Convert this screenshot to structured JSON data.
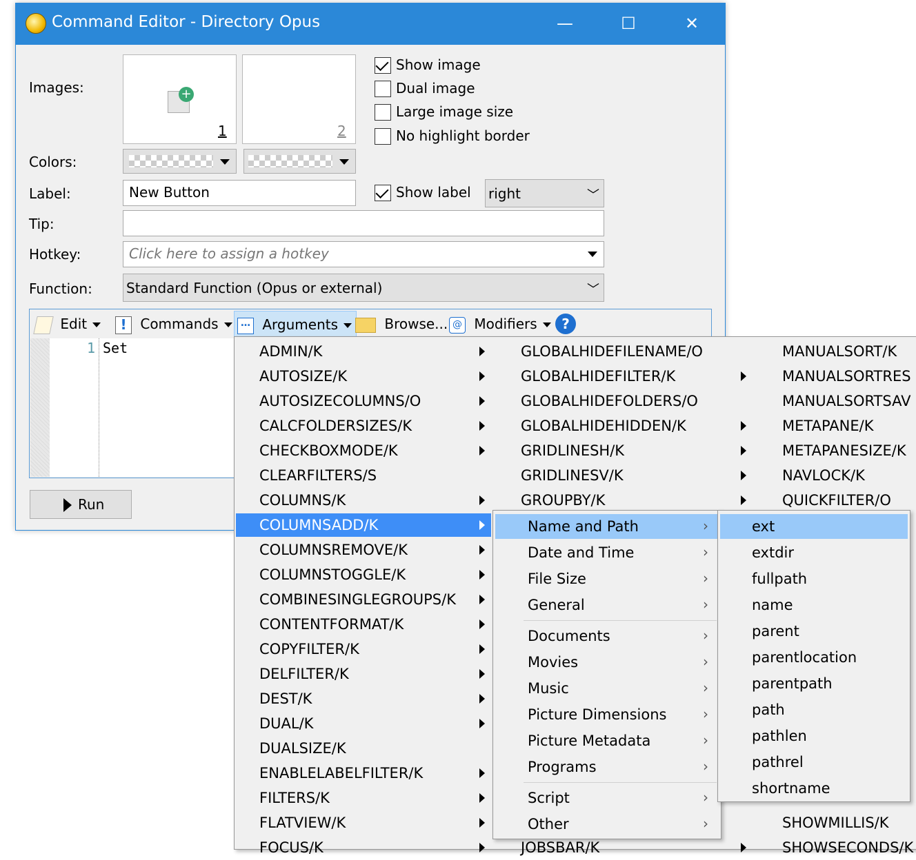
{
  "window": {
    "title": "Command Editor - Directory Opus",
    "minimize": "—",
    "maximize": "☐",
    "close": "✕"
  },
  "form": {
    "images_label": "Images:",
    "image1_num": "1",
    "image2_num": "2",
    "show_image": "Show image",
    "dual_image": "Dual image",
    "large_image": "Large image size",
    "no_highlight": "No highlight border",
    "colors_label": "Colors:",
    "label_label": "Label:",
    "label_value": "New Button",
    "show_label": "Show label",
    "label_pos": "right",
    "tip_label": "Tip:",
    "tip_value": "",
    "hotkey_label": "Hotkey:",
    "hotkey_placeholder": "Click here to assign a hotkey",
    "function_label": "Function:",
    "function_value": "Standard Function (Opus or external)",
    "show_image_checked": true,
    "dual_image_checked": false,
    "large_image_checked": false,
    "no_highlight_checked": false,
    "show_label_checked": true
  },
  "toolbar": {
    "edit": "Edit",
    "commands": "Commands",
    "arguments": "Arguments",
    "browse": "Browse...",
    "modifiers": "Modifiers",
    "help": "?"
  },
  "editor": {
    "line_number": "1",
    "code": "Set"
  },
  "run_button": "Run",
  "menu_args": {
    "col1": [
      {
        "label": "ADMIN/K",
        "sub": true
      },
      {
        "label": "AUTOSIZE/K",
        "sub": true
      },
      {
        "label": "AUTOSIZECOLUMNS/O",
        "sub": true
      },
      {
        "label": "CALCFOLDERSIZES/K",
        "sub": true
      },
      {
        "label": "CHECKBOXMODE/K",
        "sub": true
      },
      {
        "label": "CLEARFILTERS/S",
        "sub": false
      },
      {
        "label": "COLUMNS/K",
        "sub": true
      },
      {
        "label": "COLUMNSADD/K",
        "sub": true
      },
      {
        "label": "COLUMNSREMOVE/K",
        "sub": true
      },
      {
        "label": "COLUMNSTOGGLE/K",
        "sub": true
      },
      {
        "label": "COMBINESINGLEGROUPS/K",
        "sub": true
      },
      {
        "label": "CONTENTFORMAT/K",
        "sub": true
      },
      {
        "label": "COPYFILTER/K",
        "sub": true
      },
      {
        "label": "DELFILTER/K",
        "sub": true
      },
      {
        "label": "DEST/K",
        "sub": true
      },
      {
        "label": "DUAL/K",
        "sub": true
      },
      {
        "label": "DUALSIZE/K",
        "sub": false
      },
      {
        "label": "ENABLELABELFILTER/K",
        "sub": true
      },
      {
        "label": "FILTERS/K",
        "sub": true
      },
      {
        "label": "FLATVIEW/K",
        "sub": true
      },
      {
        "label": "FOCUS/K",
        "sub": true
      }
    ],
    "col2": [
      {
        "label": "GLOBALHIDEFILENAME/O",
        "sub": false
      },
      {
        "label": "GLOBALHIDEFILTER/K",
        "sub": true
      },
      {
        "label": "GLOBALHIDEFOLDERS/O",
        "sub": false
      },
      {
        "label": "GLOBALHIDEHIDDEN/K",
        "sub": true
      },
      {
        "label": "GRIDLINESH/K",
        "sub": true
      },
      {
        "label": "GRIDLINESV/K",
        "sub": true
      },
      {
        "label": "GROUPBY/K",
        "sub": true
      },
      {
        "label": "JOBSBAR/K",
        "sub": true
      }
    ],
    "col3": [
      "MANUALSORT/K",
      "MANUALSORTRES",
      "MANUALSORTSAV",
      "METAPANE/K",
      "METAPANESIZE/K",
      "NAVLOCK/K",
      "QUICKFILTER/O",
      "SHOWMILLIS/K",
      "SHOWSECONDS/K"
    ]
  },
  "menu_categories": {
    "group1": [
      "Name and Path",
      "Date and Time",
      "File Size",
      "General"
    ],
    "group2": [
      "Documents",
      "Movies",
      "Music",
      "Picture Dimensions",
      "Picture Metadata",
      "Programs"
    ],
    "group3": [
      "Script",
      "Other"
    ]
  },
  "menu_columns": [
    "ext",
    "extdir",
    "fullpath",
    "name",
    "parent",
    "parentlocation",
    "parentpath",
    "path",
    "pathlen",
    "pathrel",
    "shortname"
  ],
  "colors": {
    "titlebar": "#2b88d8",
    "highlight": "#3e8ef7",
    "submenu_highlight": "#99c9f9",
    "help_icon": "#1e6fd0"
  }
}
